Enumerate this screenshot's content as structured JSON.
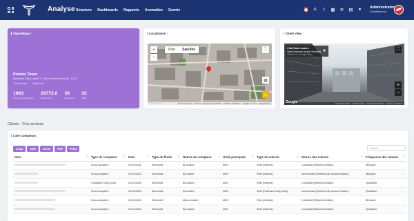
{
  "header": {
    "app_title": "Analyse",
    "nav": [
      "Structure",
      "Dashboards",
      "Rapports",
      "Anomalies",
      "Events"
    ],
    "tools": [
      "alarm-clock-icon",
      "translate-icon",
      "home-icon",
      "calendar-icon",
      "wifi-icon",
      "document-icon",
      "location-icon"
    ],
    "user_name": "Administrator",
    "user_sub": "GoodAfternoon"
  },
  "signaletique": {
    "title": "Signalétique :",
    "name": "Rotanic Tower",
    "address": "Boulevard Saint-Lazare 4 - Saint-Josse-ten-Noode - 1210",
    "meta": [
      "Tour Bureaux",
      "Dépôt actif"
    ],
    "stats": [
      {
        "value": "1963",
        "label": "Année de construction"
      },
      {
        "value": "29772.0",
        "label": "Surface (m²)"
      },
      {
        "value": "30",
        "label": "Compteurs"
      },
      {
        "value": "33",
        "label": "Tarifs"
      }
    ]
  },
  "localisation": {
    "title": "Localisation :",
    "map_type_options": [
      "Plan",
      "Satellite"
    ],
    "map_type_selected": "Satellite",
    "zoom_in": "+",
    "zoom_out": "−",
    "footer": [
      "Raccourcis clavier",
      "Données cartographiques ©2023",
      "Conditions d'utilisation",
      "Signaler une erreur cartographique"
    ],
    "brand": "Google"
  },
  "streetview": {
    "title": "Street View :",
    "place": "3 Bd Saint-Lazare",
    "place_sub": "Saint-Josse-ten-Noode, Bruxelles",
    "link": "Afficher sur Google Maps",
    "footer": [
      "Raccourcis clavier",
      "© 2023 Google",
      "Conditions d'utilisation",
      "Signaler un problème"
    ],
    "brand": "Google"
  },
  "section_label": "Clients - Flux sortants",
  "liste": {
    "title": "Liste Compteurs",
    "export_buttons": [
      "Copy",
      "CSV",
      "Excel",
      "PDF",
      "Print"
    ],
    "search_placeholder": "Search...",
    "columns": [
      "Nom",
      "Type de compteur",
      "Date",
      "Type de fluide",
      "Nature du compteur",
      "Unité principale",
      "Type de relevés",
      "Nature des relevés",
      "Fréquence des relevés"
    ],
    "rows": [
      {
        "nom_fraction": 0.78,
        "type": "Sous-compteur",
        "date": "01/01/2022",
        "fluide": "Electricité",
        "nature": "Bi-horaire",
        "unite": "kWh",
        "releves": "Réel (relevés)",
        "nature_rel": "Cumulatif (Relevés d'index)",
        "freq": "Mensuel"
      },
      {
        "nom_fraction": 0.36,
        "type": "Sous-compteur",
        "date": "01/01/2022",
        "fluide": "Electricité",
        "nature": "Bi-horaire",
        "unite": "kWh",
        "releves": "Réel (relevés)",
        "nature_rel": "Incrémental (Relevés de consommation)",
        "freq": "Mensuel"
      },
      {
        "nom_fraction": 0.36,
        "type": "Compteur Entry point",
        "date": "01/01/2000",
        "fluide": "Electricité",
        "nature": "Bi-horaire",
        "unite": "kWh",
        "releves": "Réel (relevés)",
        "nature_rel": "Cumulatif (Relevés d'index)",
        "freq": "Quotidien"
      },
      {
        "nom_fraction": 0.78,
        "type": "Sous-compteur",
        "date": "02/10/2023",
        "fluide": "Electricité",
        "nature": "Bi-horaire",
        "unite": "kWh",
        "releves": "Réel (Factures Entry point)",
        "nature_rel": "Incrémental (Relevés de consommation)",
        "freq": "Quotidien"
      },
      {
        "nom_fraction": 0.62,
        "type": "Sous-compteur",
        "date": "01/01/2022",
        "fluide": "Electricité",
        "nature": "Mono-horaire",
        "unite": "kWh",
        "releves": "Réel (relevés)",
        "nature_rel": "Cumulatif (Relevés d'index)",
        "freq": "Mensuel"
      },
      {
        "nom_fraction": 0.62,
        "type": "Sous-compteur",
        "date": "01/01/2022",
        "fluide": "Electricité",
        "nature": "Bi-horaire",
        "unite": "kWh",
        "releves": "Réel (relevés)",
        "nature_rel": "Cumulatif (Relevés d'index)",
        "freq": "Quotidien"
      }
    ]
  },
  "colors": {
    "nav_bg": "#1d3473",
    "accent_purple": "#9e71d6",
    "page_bg": "#eef0f4",
    "pin_red": "#e02a22"
  }
}
